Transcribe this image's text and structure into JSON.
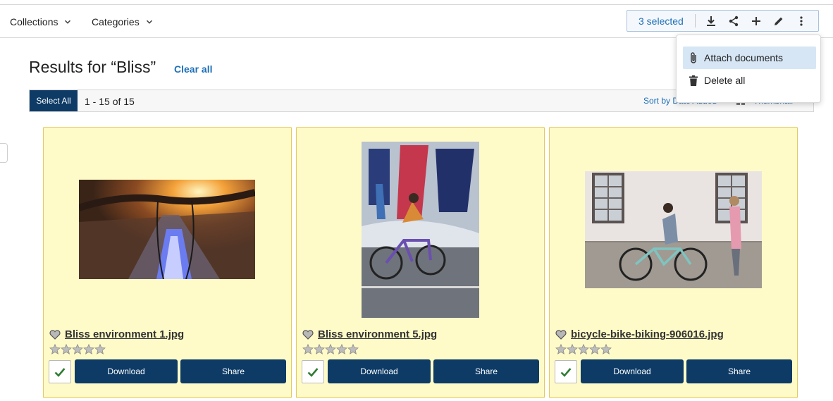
{
  "nav": {
    "collections_label": "Collections",
    "categories_label": "Categories"
  },
  "selection": {
    "count_label": "3 selected",
    "toolbar_icons": [
      "download-icon",
      "share-icon",
      "plus-icon",
      "pencil-icon",
      "more-vertical-icon"
    ]
  },
  "menu": {
    "items": [
      {
        "label": "Attach documents",
        "icon": "paperclip-icon",
        "active": true
      },
      {
        "label": "Delete all",
        "icon": "trash-icon",
        "active": false
      }
    ]
  },
  "results": {
    "title": "Results for “Bliss”",
    "clear_label": "Clear all",
    "select_all_label": "Select All",
    "range_label": "1 - 15 of 15",
    "sort_label": "Sort by Date Added",
    "view_label": "Thumbnail"
  },
  "cards": [
    {
      "filename": "Bliss environment 1.jpg",
      "download_label": "Download",
      "share_label": "Share",
      "rating": 0,
      "selected": true
    },
    {
      "filename": "Bliss environment 5.jpg",
      "download_label": "Download",
      "share_label": "Share",
      "rating": 0,
      "selected": true
    },
    {
      "filename": "bicycle-bike-biking-906016.jpg",
      "download_label": "Download",
      "share_label": "Share",
      "rating": 0,
      "selected": true
    }
  ],
  "colors": {
    "primary": "#0d3b66",
    "link": "#1d6fb8",
    "card_bg": "#fffbc8",
    "card_border": "#e6c765",
    "check": "#2e7d32"
  }
}
